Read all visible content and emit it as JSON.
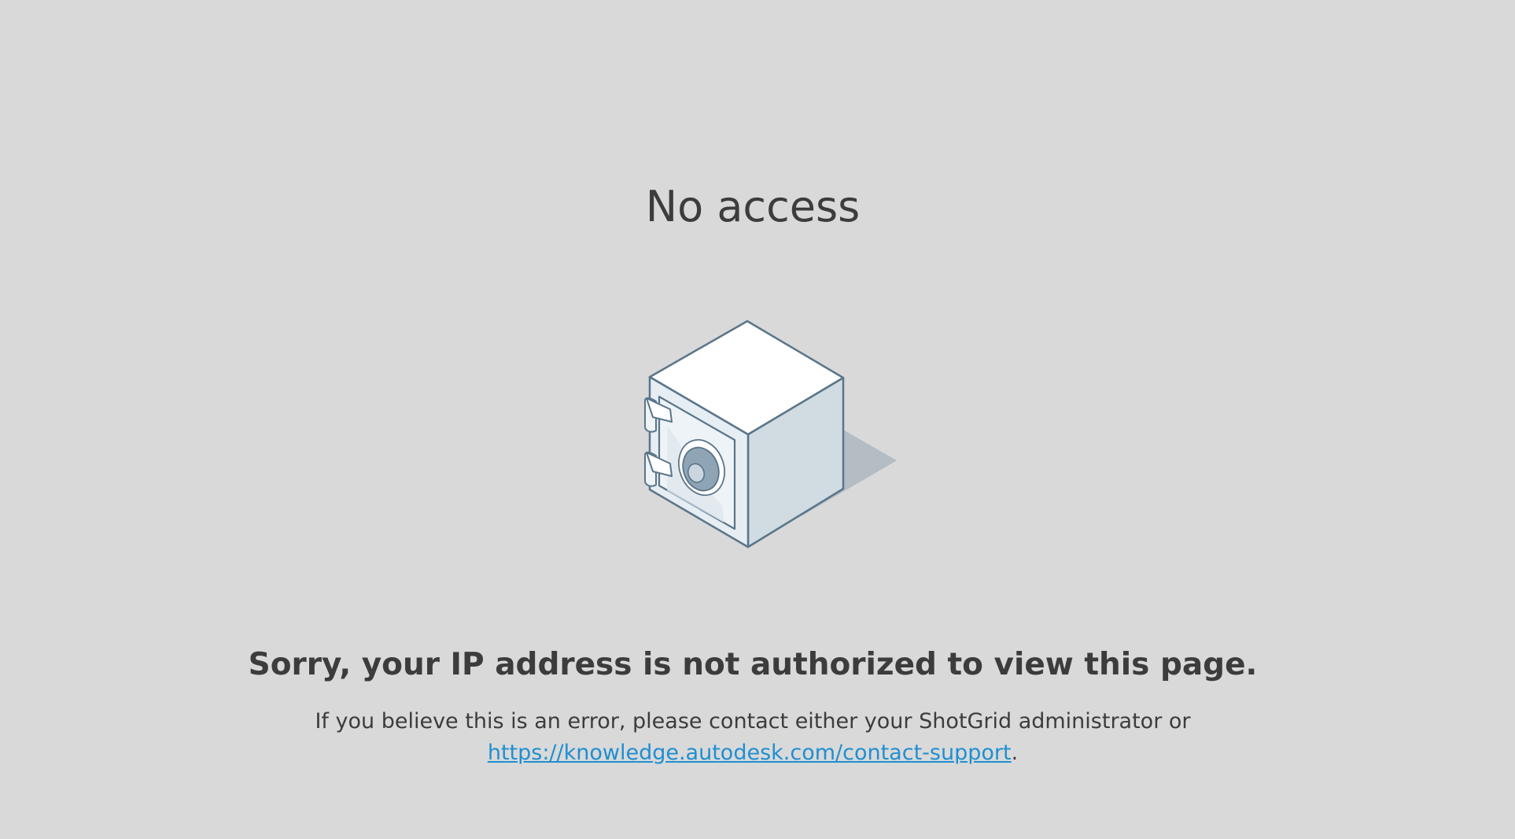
{
  "page": {
    "title": "No access",
    "headline": "Sorry, your IP address is not authorized to view this page.",
    "message_line1": "If you believe this is an error, please contact either your ShotGrid administrator or",
    "support_link": "https://knowledge.autodesk.com/contact-support",
    "message_end": ".",
    "illustration_icon": "safe-icon"
  },
  "colors": {
    "background": "#d9d9d9",
    "text": "#3c3c3c",
    "link": "#1f8fd1",
    "safe_outline": "#5a7589"
  }
}
